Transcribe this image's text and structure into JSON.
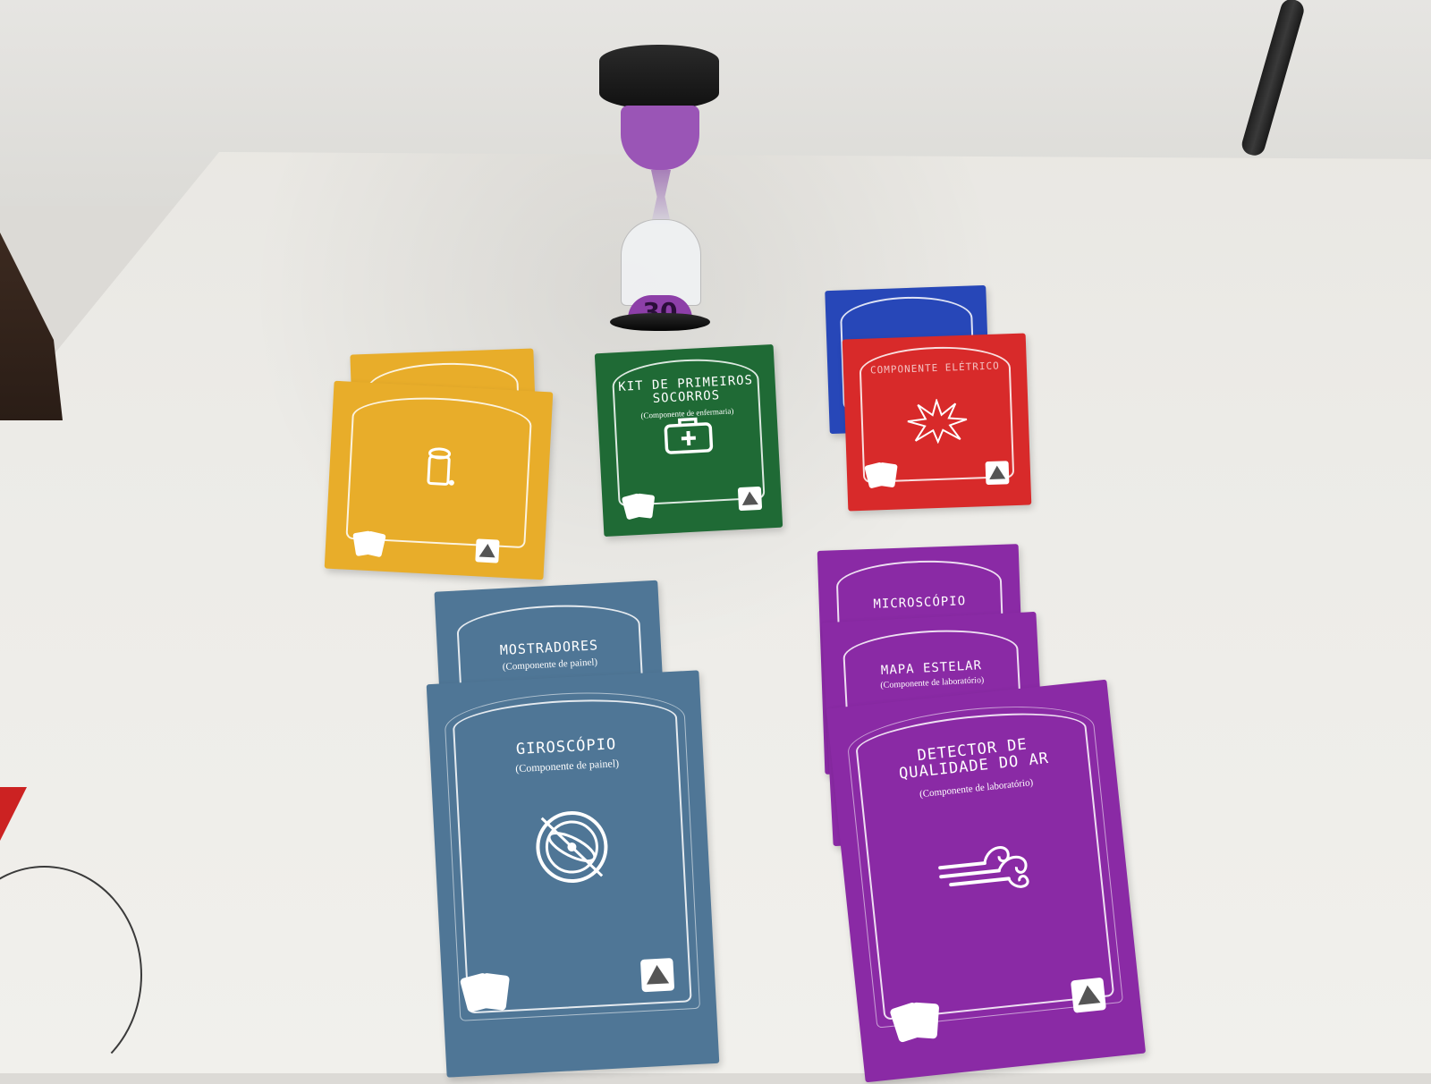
{
  "hourglass": {
    "label": "30"
  },
  "cards": {
    "green": {
      "title": "KIT DE PRIMEIROS SOCORROS",
      "subtitle": "(Componente de enfermaria)",
      "icon": "first-aid-kit-icon"
    },
    "red": {
      "title": "COMPONENTE ELÉTRICO",
      "subtitle": "",
      "icon": "spark-icon"
    },
    "mostradores": {
      "title": "MOSTRADORES",
      "subtitle": "(Componente de painel)"
    },
    "giroscopio": {
      "title": "GIROSCÓPIO",
      "subtitle": "(Componente de painel)",
      "icon": "gyroscope-icon"
    },
    "microscopio": {
      "title": "MICROSCÓPIO",
      "subtitle": ""
    },
    "mapa": {
      "title": "MAPA ESTELAR",
      "subtitle": "(Componente de laboratório)"
    },
    "detector": {
      "title": "DETECTOR DE QUALIDADE DO AR",
      "subtitle": "(Componente de laboratório)",
      "icon": "wind-icon"
    },
    "yellow": {
      "icon": "trash-can-icon"
    }
  },
  "colors": {
    "yellow": "#e8ad2a",
    "green": "#1f6a35",
    "red": "#d82a2a",
    "blue": "#2747b8",
    "slate": "#4f7696",
    "purple": "#8a2aa5"
  }
}
